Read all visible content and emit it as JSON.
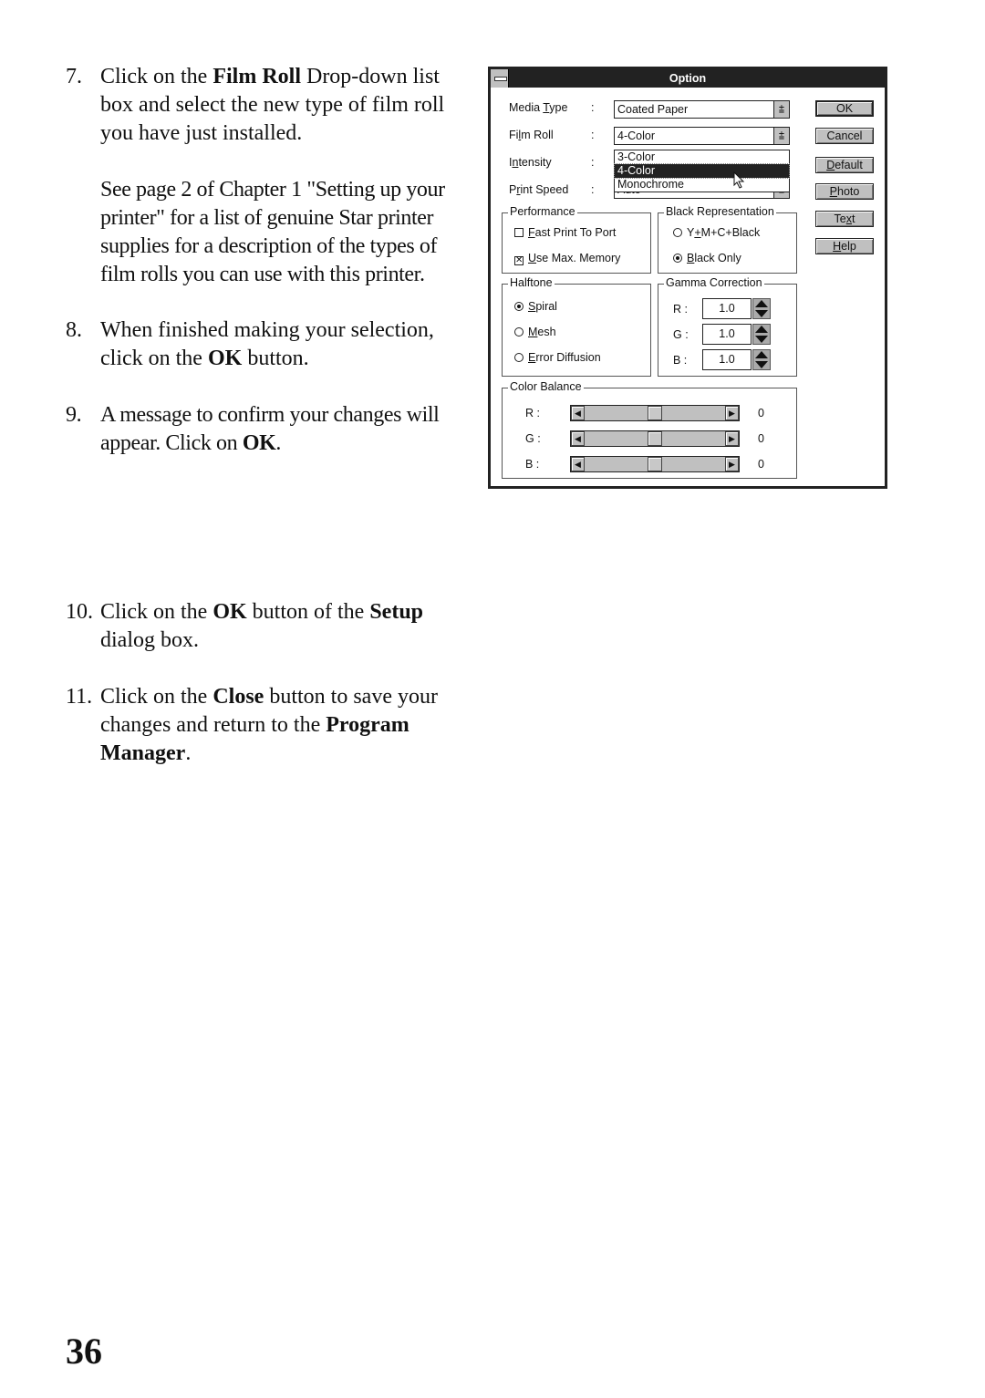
{
  "steps": [
    {
      "number": "7.",
      "paragraphs": [
        {
          "parts": [
            "Click on the ",
            "Film Roll",
            " Drop-down list box and select the new type of film roll you have just installed."
          ]
        },
        {
          "parts": [
            "See page 2 of Chapter 1 \"Setting up your printer\" for a list of genuine Star printer supplies for a description of the types of film rolls you can use with this printer."
          ]
        }
      ]
    },
    {
      "number": "8.",
      "paragraphs": [
        {
          "parts": [
            "When finished making your selection, click on the ",
            "OK",
            " button."
          ]
        }
      ]
    },
    {
      "number": "9.",
      "paragraphs": [
        {
          "parts": [
            "A message to confirm your changes will appear.  Click on ",
            "OK",
            "."
          ]
        }
      ]
    },
    {
      "number": "10.",
      "paragraphs": [
        {
          "parts": [
            "Click on the ",
            "OK",
            " button of the ",
            "Setup",
            " dialog box."
          ]
        }
      ]
    },
    {
      "number": "11.",
      "paragraphs": [
        {
          "parts": [
            "Click on the ",
            "Close",
            " button to save your changes and return to the ",
            "Program Manager",
            "."
          ]
        }
      ]
    }
  ],
  "page_number": "36",
  "dialog": {
    "title": "Option",
    "fields": {
      "media_type": {
        "label": "Media Type",
        "colon": ":",
        "value": "Coated Paper"
      },
      "film_roll": {
        "label": "Film Roll",
        "colon": ":",
        "value": "4-Color",
        "options": [
          "3-Color",
          "4-Color",
          "Monochrome"
        ],
        "highlighted": "4-Color"
      },
      "intensity": {
        "label": "Intensity",
        "colon": ":"
      },
      "print_speed": {
        "label": "Print Speed",
        "colon": ":",
        "value": "Auto"
      }
    },
    "buttons": {
      "ok": "OK",
      "cancel": "Cancel",
      "default": "Default",
      "photo": "Photo",
      "text": "Text",
      "help": "Help"
    },
    "performance": {
      "title": "Performance",
      "fast_print": {
        "label": "Fast Print To Port",
        "checked": false
      },
      "use_max_memory": {
        "label": "Use Max. Memory",
        "checked": true
      }
    },
    "black_representation": {
      "title": "Black Representation",
      "options": [
        "Y+M+C+Black",
        "Black Only"
      ],
      "selected": "Black Only"
    },
    "halftone": {
      "title": "Halftone",
      "options": [
        "Spiral",
        "Mesh",
        "Error Diffusion"
      ],
      "selected": "Spiral"
    },
    "gamma_correction": {
      "title": "Gamma Correction",
      "channels": [
        {
          "label": "R :",
          "value": "1.0"
        },
        {
          "label": "G :",
          "value": "1.0"
        },
        {
          "label": "B :",
          "value": "1.0"
        }
      ]
    },
    "color_balance": {
      "title": "Color Balance",
      "channels": [
        {
          "label": "R :",
          "value": "0",
          "position": 0.5
        },
        {
          "label": "G :",
          "value": "0",
          "position": 0.5
        },
        {
          "label": "B :",
          "value": "0",
          "position": 0.5
        }
      ]
    }
  }
}
